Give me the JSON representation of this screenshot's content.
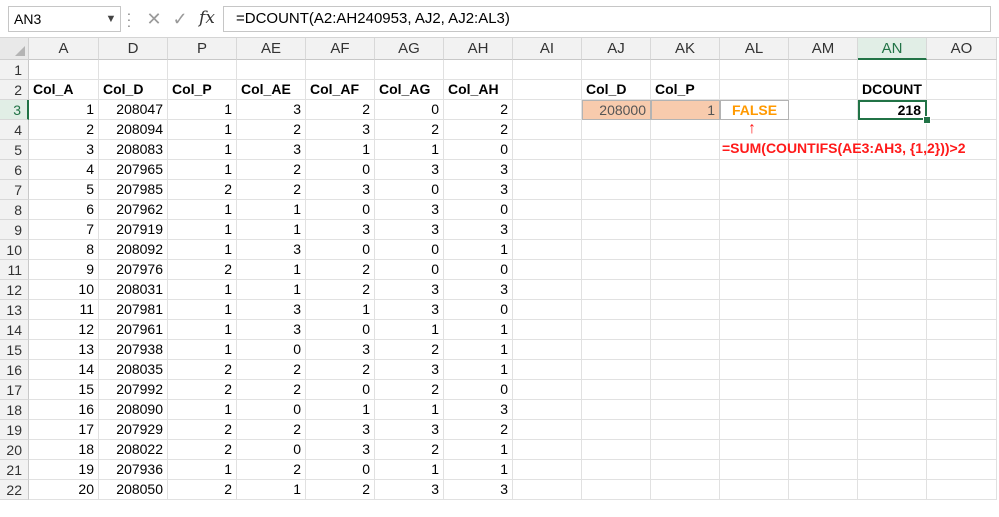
{
  "formula_bar": {
    "name_box": "AN3",
    "formula": "=DCOUNT(A2:AH240953, AJ2, AJ2:AL3)",
    "fx_label": "fx",
    "cancel_icon": "cancel-x-icon",
    "enter_icon": "checkmark-icon"
  },
  "columns": [
    "A",
    "D",
    "P",
    "AE",
    "AF",
    "AG",
    "AH",
    "AI",
    "AJ",
    "AK",
    "AL",
    "AM",
    "AN",
    "AO"
  ],
  "selected_column": "AN",
  "rows": [
    "1",
    "2",
    "3",
    "4",
    "5",
    "6",
    "7",
    "8",
    "9",
    "10",
    "11",
    "12",
    "13",
    "14",
    "15",
    "16",
    "17",
    "18",
    "19",
    "20",
    "21",
    "22"
  ],
  "selected_row": "3",
  "table_headers": [
    "Col_A",
    "Col_D",
    "Col_P",
    "Col_AE",
    "Col_AF",
    "Col_AG",
    "Col_AH"
  ],
  "table_rows": [
    [
      "1",
      "208047",
      "1",
      "3",
      "2",
      "0",
      "2"
    ],
    [
      "2",
      "208094",
      "1",
      "2",
      "3",
      "2",
      "2"
    ],
    [
      "3",
      "208083",
      "1",
      "3",
      "1",
      "1",
      "0"
    ],
    [
      "4",
      "207965",
      "1",
      "2",
      "0",
      "3",
      "3"
    ],
    [
      "5",
      "207985",
      "2",
      "2",
      "3",
      "0",
      "3"
    ],
    [
      "6",
      "207962",
      "1",
      "1",
      "0",
      "3",
      "0"
    ],
    [
      "7",
      "207919",
      "1",
      "1",
      "3",
      "3",
      "3"
    ],
    [
      "8",
      "208092",
      "1",
      "3",
      "0",
      "0",
      "1"
    ],
    [
      "9",
      "207976",
      "2",
      "1",
      "2",
      "0",
      "0"
    ],
    [
      "10",
      "208031",
      "1",
      "1",
      "2",
      "3",
      "3"
    ],
    [
      "11",
      "207981",
      "1",
      "3",
      "1",
      "3",
      "0"
    ],
    [
      "12",
      "207961",
      "1",
      "3",
      "0",
      "1",
      "1"
    ],
    [
      "13",
      "207938",
      "1",
      "0",
      "3",
      "2",
      "1"
    ],
    [
      "14",
      "208035",
      "2",
      "2",
      "2",
      "3",
      "1"
    ],
    [
      "15",
      "207992",
      "2",
      "2",
      "0",
      "2",
      "0"
    ],
    [
      "16",
      "208090",
      "1",
      "0",
      "1",
      "1",
      "3"
    ],
    [
      "17",
      "207929",
      "2",
      "2",
      "3",
      "3",
      "2"
    ],
    [
      "18",
      "208022",
      "2",
      "0",
      "3",
      "2",
      "1"
    ],
    [
      "19",
      "207936",
      "1",
      "2",
      "0",
      "1",
      "1"
    ],
    [
      "20",
      "208050",
      "2",
      "1",
      "2",
      "3",
      "3"
    ]
  ],
  "criteria": {
    "header_d": "Col_D",
    "header_p": "Col_P",
    "value_d": "208000",
    "value_p": "1",
    "result_bool": "FALSE"
  },
  "dcount": {
    "label": "DCOUNT",
    "value": "218"
  },
  "annotation": {
    "arrow": "↑",
    "text": "=SUM(COUNTIFS(AE3:AH3, {1,2}))>2"
  },
  "colors": {
    "accent_green": "#217346",
    "criteria_fill": "#f8cbad",
    "false_text": "#ff9900",
    "annotation_red": "#ff1a1a"
  }
}
